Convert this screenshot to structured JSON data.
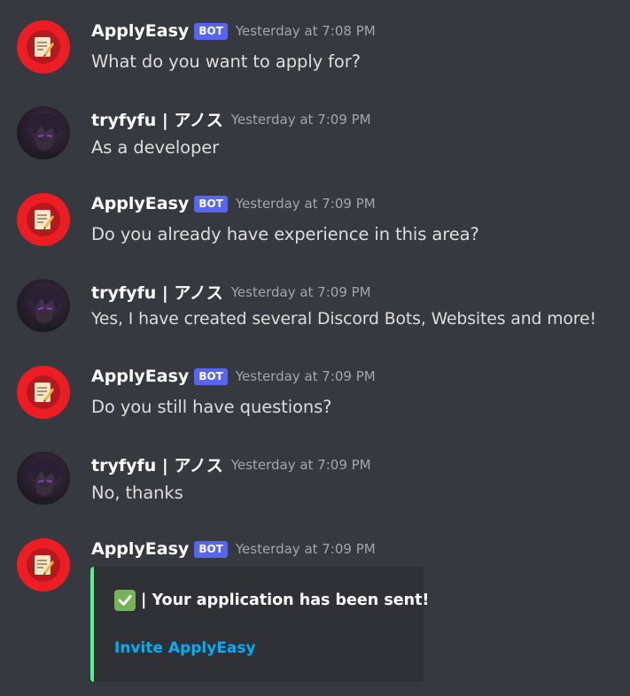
{
  "messages": [
    {
      "author": "ApplyEasy",
      "badge": "BOT",
      "time": "Yesterday at 7:08 PM",
      "text": "What do you want to apply for?"
    },
    {
      "author": "tryfyfu | アノス",
      "time": "Yesterday at 7:09 PM",
      "text": "As a developer"
    },
    {
      "author": "ApplyEasy",
      "badge": "BOT",
      "time": "Yesterday at 7:09 PM",
      "text": "Do you already have experience in this area?"
    },
    {
      "author": "tryfyfu | アノス",
      "time": "Yesterday at 7:09 PM",
      "text": "Yes, I have created several Discord Bots, Websites and more!"
    },
    {
      "author": "ApplyEasy",
      "badge": "BOT",
      "time": "Yesterday at 7:09 PM",
      "text": "Do you still have questions?"
    },
    {
      "author": "tryfyfu | アノス",
      "time": "Yesterday at 7:09 PM",
      "text": "No, thanks"
    },
    {
      "author": "ApplyEasy",
      "badge": "BOT",
      "time": "Yesterday at 7:09 PM"
    }
  ],
  "embed": {
    "title": "| Your application has been sent!",
    "title_icon": "check-mark-button-icon",
    "link": "Invite ApplyEasy",
    "accent_color": "#57f287"
  },
  "colors": {
    "background": "#36393f",
    "bot_badge": "#5865f2",
    "link": "#00aff4"
  }
}
